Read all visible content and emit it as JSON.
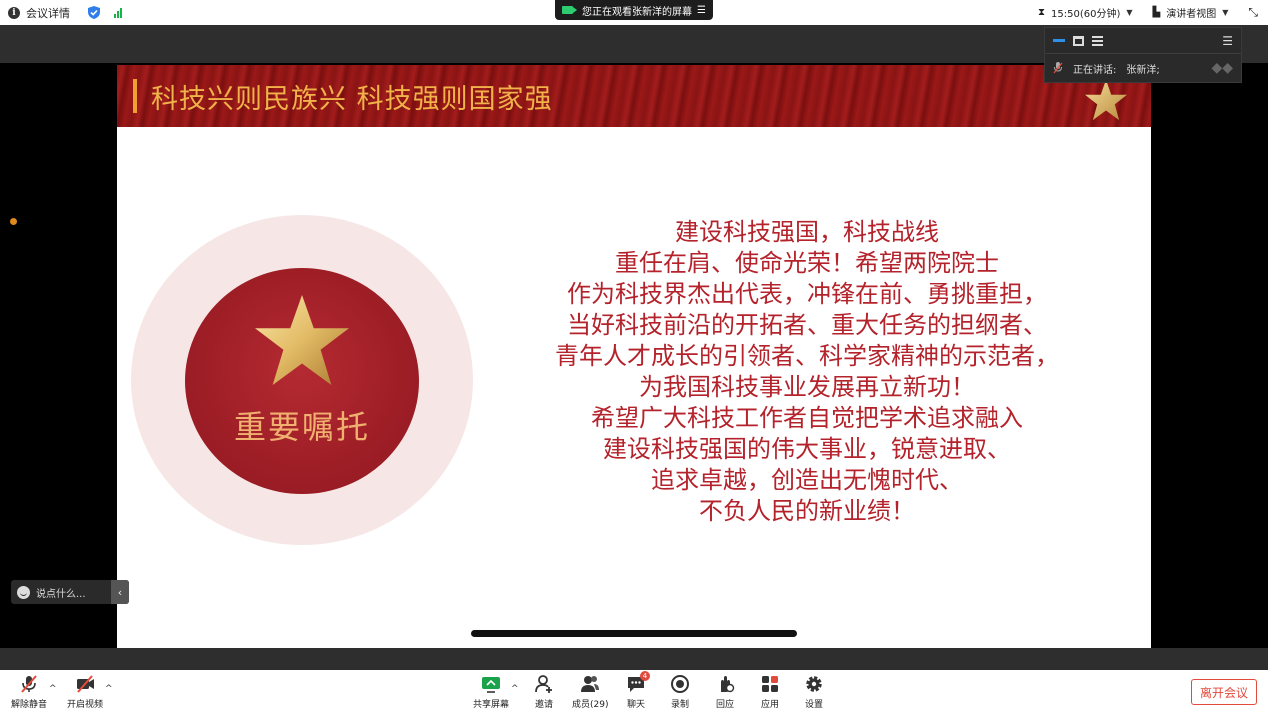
{
  "topbar": {
    "meeting_info_label": "会议详情",
    "sharing_banner": "您正在观看张新洋的屏幕",
    "time_label": "15:50(60分钟)",
    "view_mode_label": "演讲者视图"
  },
  "speaker_panel": {
    "speaking_label": "正在讲话:",
    "speaker_name": "张新洋;"
  },
  "slide": {
    "title": "科技兴则民族兴   科技强则国家强",
    "badge_label": "重要嘱托",
    "lines": [
      "建设科技强国，科技战线",
      "重任在肩、使命光荣！希望两院院士",
      "作为科技界杰出代表，冲锋在前、勇挑重担，",
      "当好科技前沿的开拓者、重大任务的担纲者、",
      "青年人才成长的引领者、科学家精神的示范者，",
      "为我国科技事业发展再立新功！",
      "希望广大科技工作者自觉把学术追求融入",
      "建设科技强国的伟大事业，锐意进取、",
      "追求卓越，创造出无愧时代、",
      "不负人民的新业绩！"
    ],
    "colors": {
      "header": "#8a1414",
      "title": "#f1b24a",
      "body_text": "#b4232b",
      "disc": "#9a1c24"
    }
  },
  "chat": {
    "placeholder": "说点什么..."
  },
  "toolbar": {
    "unmute_label": "解除静音",
    "video_label": "开启视频",
    "share_label": "共享屏幕",
    "invite_label": "邀请",
    "members_label": "成员(29)",
    "chat_label": "聊天",
    "chat_badge": "4",
    "record_label": "录制",
    "interact_label": "回应",
    "apps_label": "应用",
    "settings_label": "设置",
    "leave_label": "离开会议"
  }
}
